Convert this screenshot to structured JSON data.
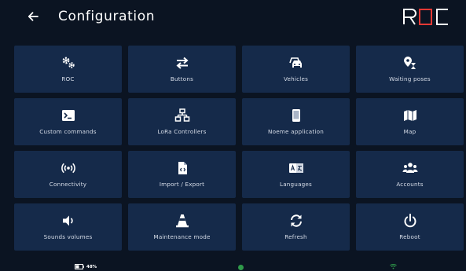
{
  "header": {
    "title": "Configuration",
    "brand": "ROC",
    "accent_color": "#e53935"
  },
  "tiles": [
    {
      "label": "ROC",
      "icon": "gear-icon"
    },
    {
      "label": "Buttons",
      "icon": "swap-arrows-icon"
    },
    {
      "label": "Vehicles",
      "icon": "vehicles-icon"
    },
    {
      "label": "Waiting poses",
      "icon": "location-hourglass-icon"
    },
    {
      "label": "Custom commands",
      "icon": "terminal-icon"
    },
    {
      "label": "LoRa Controllers",
      "icon": "network-icon"
    },
    {
      "label": "Noeme application",
      "icon": "tablet-icon"
    },
    {
      "label": "Map",
      "icon": "map-icon"
    },
    {
      "label": "Connectivity",
      "icon": "signal-icon"
    },
    {
      "label": "Import / Export",
      "icon": "file-code-icon"
    },
    {
      "label": "Languages",
      "icon": "translate-icon"
    },
    {
      "label": "Accounts",
      "icon": "people-icon"
    },
    {
      "label": "Sounds volumes",
      "icon": "volume-icon"
    },
    {
      "label": "Maintenance mode",
      "icon": "cone-icon"
    },
    {
      "label": "Refresh",
      "icon": "refresh-icon"
    },
    {
      "label": "Reboot",
      "icon": "power-icon"
    }
  ],
  "status": {
    "battery": "48%",
    "battery_level": 0.48,
    "connection_color": "#2f9a4a",
    "wifi_color": "#2f9a4a"
  }
}
